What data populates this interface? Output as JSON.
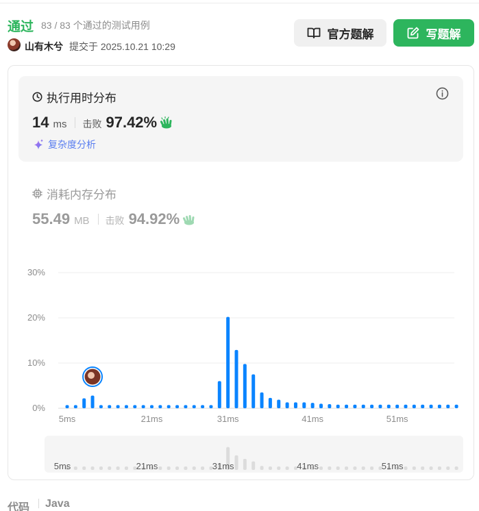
{
  "header": {
    "status": "通过",
    "passcount": "83 / 83 个通过的测试用例",
    "username": "山有木兮",
    "submitted": "提交于 2025.10.21 10:29",
    "official_label": "官方题解",
    "write_label": "写题解"
  },
  "runtime": {
    "title": "执行用时分布",
    "value": "14",
    "unit": "ms",
    "beat_label": "击败",
    "beat_pct": "97.42%",
    "complexity_label": "复杂度分析"
  },
  "memory": {
    "title": "消耗内存分布",
    "value": "55.49",
    "unit": "MB",
    "beat_label": "击败",
    "beat_pct": "94.92%"
  },
  "colors": {
    "accent_green": "#2db55d",
    "bar_blue": "#0a84ff",
    "link_purple": "#5b7ff0",
    "wave_green": "#2db55d"
  },
  "chart_data": {
    "type": "bar",
    "ylim": [
      0,
      30
    ],
    "yticks": [
      "30%",
      "20%",
      "10%",
      "0%"
    ],
    "ytick_values": [
      30,
      20,
      10,
      0
    ],
    "xtick_labels": [
      "5ms",
      "21ms",
      "31ms",
      "41ms",
      "51ms"
    ],
    "xtick_index": [
      0,
      10,
      19,
      29,
      39
    ],
    "values": [
      0.7,
      0.7,
      2.2,
      2.8,
      0.7,
      0.7,
      0.7,
      0.7,
      0.7,
      0.7,
      0.7,
      0.7,
      0.7,
      0.7,
      0.7,
      0.7,
      0.7,
      0.7,
      6.0,
      20.2,
      12.9,
      9.8,
      7.5,
      3.5,
      2.3,
      1.9,
      1.3,
      1.3,
      1.3,
      1.2,
      1.0,
      0.9,
      0.8,
      0.8,
      0.8,
      0.8,
      0.8,
      0.8,
      0.8,
      0.8,
      0.8,
      0.8,
      0.8,
      0.8,
      0.8,
      0.8,
      0.8
    ],
    "user_index": 3,
    "grid": true
  },
  "code": {
    "label": "代码",
    "lang": "Java"
  }
}
